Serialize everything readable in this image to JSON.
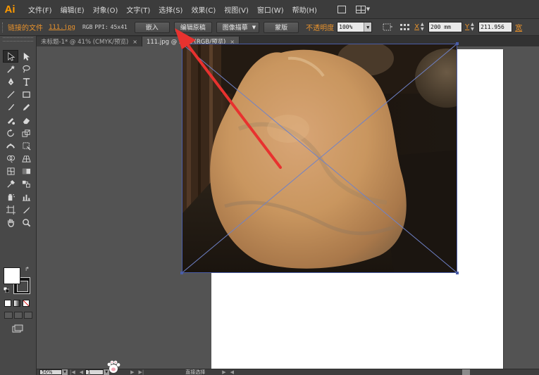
{
  "app": {
    "logo": "Ai"
  },
  "menu": [
    {
      "label": "文件(F)"
    },
    {
      "label": "编辑(E)"
    },
    {
      "label": "对象(O)"
    },
    {
      "label": "文字(T)"
    },
    {
      "label": "选择(S)"
    },
    {
      "label": "效果(C)"
    },
    {
      "label": "视图(V)"
    },
    {
      "label": "窗口(W)"
    },
    {
      "label": "帮助(H)"
    }
  ],
  "menubar_icons": [
    "bridge-square-icon",
    "arrange-documents-icon"
  ],
  "controlbar": {
    "link_label": "链接的文件",
    "file_name": "111.jpg",
    "color_mode": "RGB",
    "ppi_label": "PPI:",
    "ppi_value": "45x41",
    "embed_button": "嵌入",
    "edit_original_button": "编辑原稿",
    "image_trace_button": "图像描摹",
    "mask_button": "蒙版",
    "opacity_label": "不透明度",
    "opacity_value": "100%",
    "x_label": "X",
    "x_value": "200 mm",
    "y_label": "Y",
    "y_value": "211.956",
    "w_label": "宽"
  },
  "tabs": [
    {
      "label": "未标题-1* @ 41% (CMYK/预览)",
      "active": false,
      "close": "×"
    },
    {
      "label": "111.jpg @ 50% (RGB/预览)",
      "active": true,
      "close": "×"
    }
  ],
  "tools": [
    "selection-tool-icon",
    "direct-selection-tool-icon",
    "magic-wand-tool-icon",
    "lasso-tool-icon",
    "pen-tool-icon",
    "type-tool-icon",
    "line-segment-tool-icon",
    "rectangle-tool-icon",
    "paintbrush-tool-icon",
    "pencil-tool-icon",
    "blob-brush-tool-icon",
    "eraser-tool-icon",
    "rotate-tool-icon",
    "scale-tool-icon",
    "width-tool-icon",
    "free-transform-tool-icon",
    "shape-builder-tool-icon",
    "perspective-grid-tool-icon",
    "mesh-tool-icon",
    "gradient-tool-icon",
    "eyedropper-tool-icon",
    "blend-tool-icon",
    "symbol-sprayer-tool-icon",
    "column-graph-tool-icon",
    "artboard-tool-icon",
    "slice-tool-icon",
    "hand-tool-icon",
    "zoom-tool-icon"
  ],
  "colors": {
    "fill": "#ffffff",
    "stroke": "#121212",
    "accent_orange": "#e8922c",
    "selection_blue": "#4a5da8",
    "annotation_red": "#e8322f"
  },
  "statusbar": {
    "zoom": "50%",
    "page": "1",
    "tool_name": "直接选择"
  }
}
